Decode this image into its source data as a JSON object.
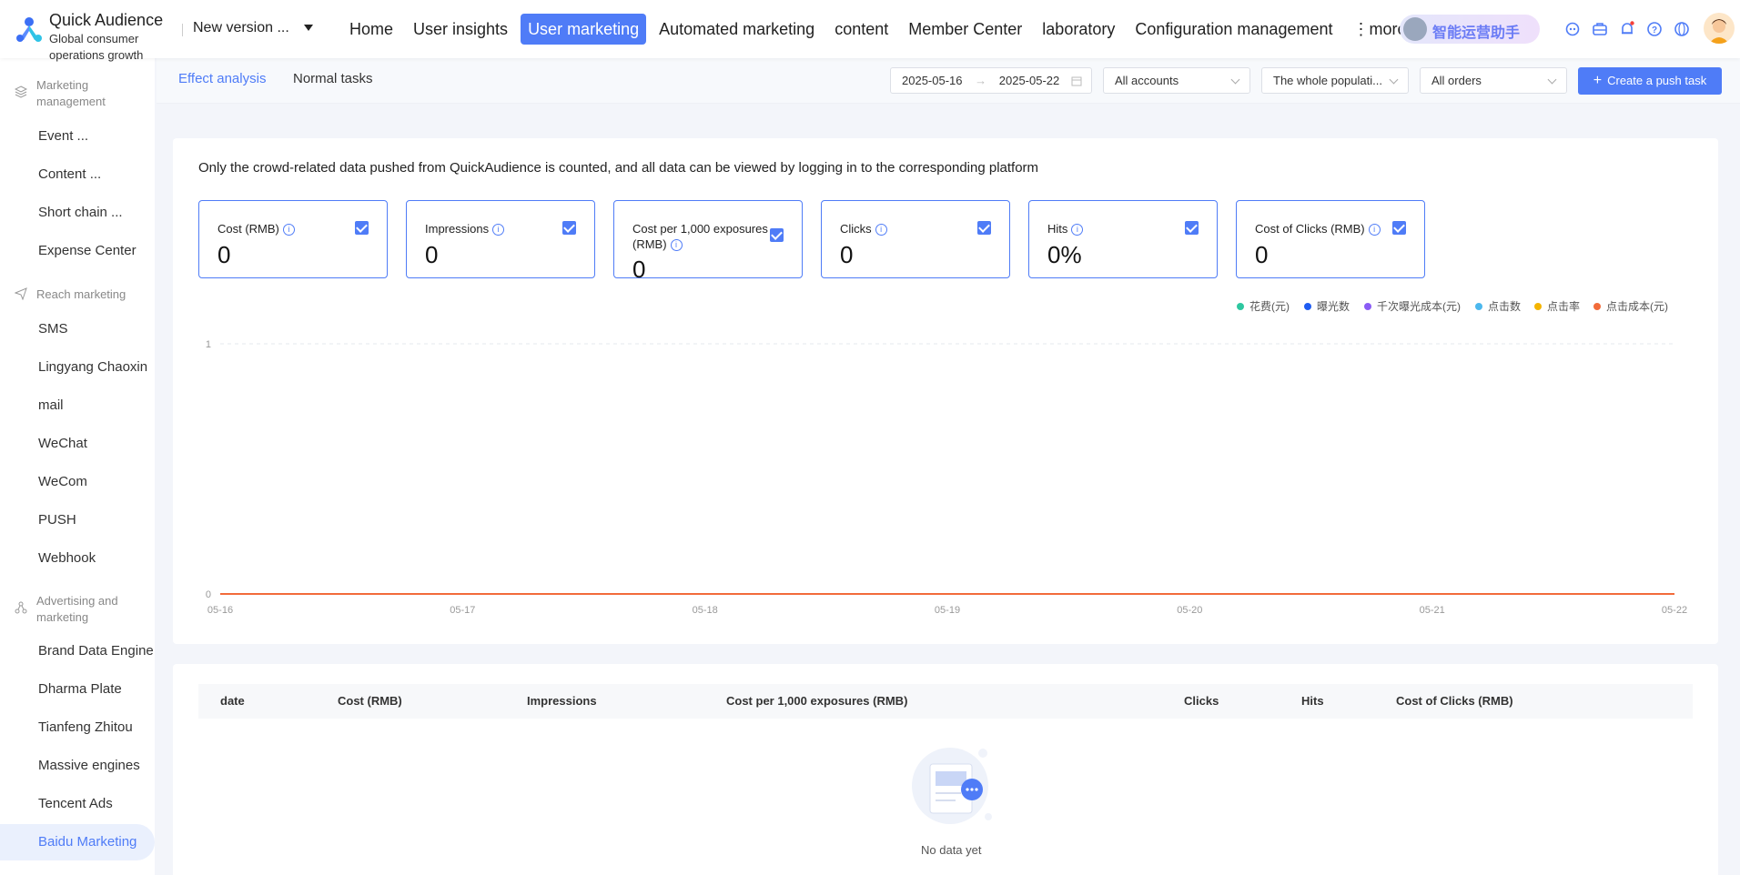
{
  "header": {
    "app_title": "Quick Audience",
    "app_subtitle": "Global consumer operations growth",
    "version": "New version ...",
    "nav": [
      {
        "label": "Home"
      },
      {
        "label": "User insights"
      },
      {
        "label": "User marketing",
        "active": true
      },
      {
        "label": "Automated marketing"
      },
      {
        "label": "content"
      },
      {
        "label": "Member Center"
      },
      {
        "label": "laboratory"
      },
      {
        "label": "Configuration management"
      },
      {
        "label": "⋮more"
      }
    ],
    "assistant_label": "智能运营助手",
    "icons": [
      "robot-icon",
      "briefcase-icon",
      "bell-icon",
      "help-icon",
      "globe-icon"
    ]
  },
  "sidebar": {
    "groups": [
      {
        "label": "Marketing management",
        "icon": "layers-icon"
      },
      {
        "label": "Reach marketing",
        "icon": "send-icon"
      },
      {
        "label": "Advertising and marketing",
        "icon": "network-icon"
      }
    ],
    "items": [
      {
        "label": "Event ..."
      },
      {
        "label": "Content ..."
      },
      {
        "label": "Short chain ..."
      },
      {
        "label": "Expense Center"
      },
      {
        "label": "SMS"
      },
      {
        "label": "Lingyang Chaoxin"
      },
      {
        "label": "mail"
      },
      {
        "label": "WeChat"
      },
      {
        "label": "WeCom"
      },
      {
        "label": "PUSH"
      },
      {
        "label": "Webhook"
      },
      {
        "label": "Brand Data Engine"
      },
      {
        "label": "Dharma Plate"
      },
      {
        "label": "Tianfeng Zhitou"
      },
      {
        "label": "Massive engines"
      },
      {
        "label": "Tencent Ads"
      },
      {
        "label": "Baidu Marketing",
        "active": true
      }
    ]
  },
  "toolbar": {
    "tabs": [
      {
        "label": "Effect analysis",
        "active": true
      },
      {
        "label": "Normal tasks"
      }
    ],
    "date_start": "2025-05-16",
    "date_sep": "→",
    "date_end": "2025-05-22",
    "accounts": "All accounts",
    "population": "The whole populati...",
    "orders": "All orders",
    "create_button": "Create a push task"
  },
  "notice": "Only the crowd-related data pushed from QuickAudience is counted, and all data can be viewed by logging in to the corresponding platform",
  "metrics": [
    {
      "label": "Cost (RMB)",
      "value": "0",
      "checked": true
    },
    {
      "label": "Impressions",
      "value": "0",
      "checked": true
    },
    {
      "label": "Cost per 1,000 exposures (RMB)",
      "value": "0",
      "checked": true
    },
    {
      "label": "Clicks",
      "value": "0",
      "checked": true
    },
    {
      "label": "Hits",
      "value": "0%",
      "checked": true
    },
    {
      "label": "Cost of Clicks (RMB)",
      "value": "0",
      "checked": true
    }
  ],
  "chart_data": {
    "type": "line",
    "x": [
      "05-16",
      "05-17",
      "05-18",
      "05-19",
      "05-20",
      "05-21",
      "05-22"
    ],
    "ylim": [
      0,
      1
    ],
    "yticks": [
      "1",
      "0"
    ],
    "legend_position": "top-right",
    "grid": true,
    "series": [
      {
        "name": "花费(元)",
        "color": "#2ec7a0",
        "values": [
          0,
          0,
          0,
          0,
          0,
          0,
          0
        ]
      },
      {
        "name": "曝光数",
        "color": "#1f5cf2",
        "values": [
          0,
          0,
          0,
          0,
          0,
          0,
          0
        ]
      },
      {
        "name": "千次曝光成本(元)",
        "color": "#8a5cf5",
        "values": [
          0,
          0,
          0,
          0,
          0,
          0,
          0
        ]
      },
      {
        "name": "点击数",
        "color": "#4cb8ee",
        "values": [
          0,
          0,
          0,
          0,
          0,
          0,
          0
        ]
      },
      {
        "name": "点击率",
        "color": "#f4b400",
        "values": [
          0,
          0,
          0,
          0,
          0,
          0,
          0
        ]
      },
      {
        "name": "点击成本(元)",
        "color": "#f26b3a",
        "values": [
          0,
          0,
          0,
          0,
          0,
          0,
          0
        ]
      }
    ]
  },
  "table": {
    "columns": [
      "date",
      "Cost (RMB)",
      "Impressions",
      "Cost per 1,000 exposures (RMB)",
      "Clicks",
      "Hits",
      "Cost of Clicks (RMB)"
    ],
    "rows": [],
    "empty_text": "No data yet"
  }
}
